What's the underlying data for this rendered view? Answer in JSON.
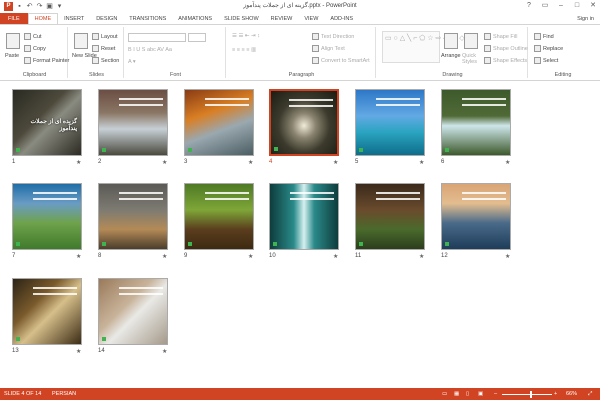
{
  "window": {
    "title": "گزینه ای از جملات پندآموز.pptx - PowerPoint",
    "signin": "Sign in"
  },
  "tabs": [
    "FILE",
    "HOME",
    "INSERT",
    "DESIGN",
    "TRANSITIONS",
    "ANIMATIONS",
    "SLIDE SHOW",
    "REVIEW",
    "VIEW",
    "ADD-INS"
  ],
  "active_tab": "HOME",
  "ribbon": {
    "clipboard": {
      "name": "Clipboard",
      "paste": "Paste",
      "cut": "Cut",
      "copy": "Copy",
      "format_painter": "Format Painter"
    },
    "slides": {
      "name": "Slides",
      "new_slide": "New Slide",
      "layout": "Layout",
      "reset": "Reset",
      "section": "Section"
    },
    "font": {
      "name": "Font"
    },
    "paragraph": {
      "name": "Paragraph",
      "text_direction": "Text Direction",
      "align_text": "Align Text",
      "convert": "Convert to SmartArt"
    },
    "drawing": {
      "name": "Drawing",
      "arrange": "Arrange",
      "quick_styles": "Quick Styles",
      "shape_fill": "Shape Fill",
      "shape_outline": "Shape Outline",
      "shape_effects": "Shape Effects"
    },
    "editing": {
      "name": "Editing",
      "find": "Find",
      "replace": "Replace",
      "select": "Select"
    }
  },
  "slides": [
    {
      "num": "1",
      "title": "گزیده ای از جملات پندآموز",
      "bg": "linear-gradient(135deg,#2a2a22 0%,#4d4a3c 40%,#8a8b80 55%,#2c2a22 100%)",
      "selected": false
    },
    {
      "num": "2",
      "title": "",
      "bg": "linear-gradient(180deg,#6b4e44 0%,#8a7664 35%,#c7d0d6 60%,#4b4a3e 100%)",
      "selected": false
    },
    {
      "num": "3",
      "title": "",
      "bg": "linear-gradient(160deg,#8a3b14 0%,#d97f24 35%,#9aa8b0 60%,#4b5e62 100%)",
      "selected": false
    },
    {
      "num": "4",
      "title": "",
      "bg": "radial-gradient(ellipse at 50% 55%,#f0ebd8 0%,#8a8470 25%,#3b3a2c 55%,#1c1c14 100%)",
      "selected": true
    },
    {
      "num": "5",
      "title": "",
      "bg": "linear-gradient(180deg,#2e77c7 0%,#62a9e4 40%,#2aa4c0 65%,#0e6d8a 100%)",
      "selected": false
    },
    {
      "num": "6",
      "title": "",
      "bg": "linear-gradient(180deg,#3d5a2c 0%,#506a36 40%,#cfe6ea 55%,#3d5a2c 100%)",
      "selected": false
    },
    {
      "num": "7",
      "title": "",
      "bg": "linear-gradient(180deg,#1f6ea8 0%,#6a9cc4 30%,#6fa24b 60%,#3f7a2c 100%)",
      "selected": false
    },
    {
      "num": "8",
      "title": "",
      "bg": "linear-gradient(180deg,#5b5a55 0%,#7d7b72 40%,#b48a56 70%,#4a3d2c 100%)",
      "selected": false
    },
    {
      "num": "9",
      "title": "",
      "bg": "linear-gradient(180deg,#4f7a24 0%,#7ea638 40%,#5a3d1d 70%,#3d2a12 100%)",
      "selected": false
    },
    {
      "num": "10",
      "title": "",
      "bg": "linear-gradient(90deg,#0e3d3d 0%,#2a8a8a 35%,#d6f0f0 50%,#2a8a8a 65%,#0e3d3d 100%)",
      "selected": false
    },
    {
      "num": "11",
      "title": "",
      "bg": "linear-gradient(180deg,#3b2a1c 0%,#6a4b2c 40%,#4a6a2c 70%,#2c3d1c 100%)",
      "selected": false
    },
    {
      "num": "12",
      "title": "",
      "bg": "linear-gradient(180deg,#d9a476 0%,#e3bd8f 30%,#4a6a8a 60%,#1e3d5a 100%)",
      "selected": false
    },
    {
      "num": "13",
      "title": "",
      "bg": "linear-gradient(135deg,#2c2416 0%,#7a5a2c 35%,#d6bf8a 55%,#3d2c16 100%)",
      "selected": false
    },
    {
      "num": "14",
      "title": "",
      "bg": "linear-gradient(135deg,#9a7a5a 0%,#c8b39a 40%,#e9e9e6 55%,#a59a8a 100%)",
      "selected": false
    }
  ],
  "status": {
    "slide_info": "SLIDE 4 OF 14",
    "language": "PERSIAN",
    "zoom": "66%"
  },
  "colors": {
    "accent": "#d04423"
  }
}
